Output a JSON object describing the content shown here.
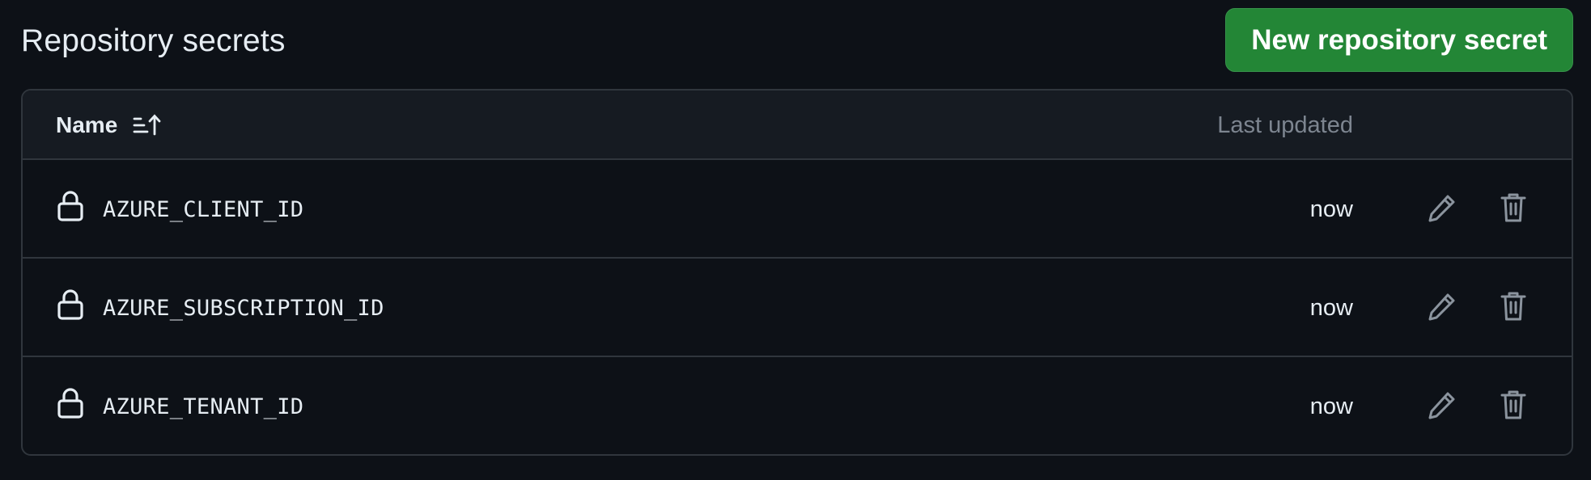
{
  "header": {
    "title": "Repository secrets",
    "new_button_label": "New repository secret"
  },
  "table": {
    "columns": {
      "name": "Name",
      "last_updated": "Last updated"
    },
    "rows": [
      {
        "name": "AZURE_CLIENT_ID",
        "updated": "now"
      },
      {
        "name": "AZURE_SUBSCRIPTION_ID",
        "updated": "now"
      },
      {
        "name": "AZURE_TENANT_ID",
        "updated": "now"
      }
    ]
  },
  "icons": {
    "sort": "sort-ascending-icon",
    "lock": "lock-icon",
    "edit": "pencil-icon",
    "delete": "trash-icon"
  },
  "colors": {
    "background": "#0d1117",
    "table_header_bg": "#161b22",
    "border": "#30363d",
    "primary_button": "#238636",
    "muted_text": "#7d8590",
    "text": "#e6edf3"
  }
}
